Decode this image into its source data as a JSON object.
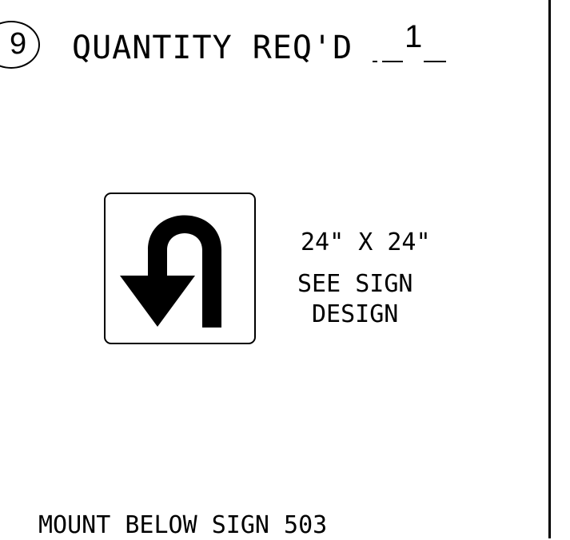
{
  "callout": {
    "number": "9"
  },
  "quantity": {
    "label": "QUANTITY REQ'D",
    "value": "1"
  },
  "sign": {
    "icon": "u-turn-arrow-icon"
  },
  "spec": {
    "size": "24\" X 24\"",
    "see_line1": "SEE SIGN",
    "see_line2": "DESIGN"
  },
  "mount_note": "MOUNT BELOW SIGN 503"
}
